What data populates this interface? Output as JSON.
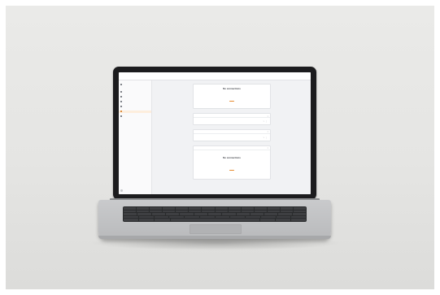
{
  "app": {
    "logo": "",
    "breadcrumb": "",
    "top_right": [
      "",
      "",
      ""
    ]
  },
  "sidebar": {
    "items": [
      {
        "label": "",
        "icon": "home-icon",
        "active": false
      },
      {
        "label": "",
        "icon": "folder-icon",
        "active": false
      },
      {
        "label": "",
        "icon": "chart-icon",
        "active": false
      },
      {
        "label": "",
        "icon": "layers-icon",
        "active": false
      },
      {
        "label": "",
        "icon": "users-icon",
        "active": false
      },
      {
        "label": "",
        "icon": "link-icon",
        "active": true
      },
      {
        "label": "",
        "icon": "gear-icon",
        "active": false
      }
    ],
    "footer": ""
  },
  "cards": {
    "empty_top": {
      "title": "No connections",
      "text": "",
      "button": ""
    },
    "connection_1": {
      "name": "",
      "tag": "",
      "field_a": "",
      "field_b": "",
      "value_a": "",
      "value_b": ""
    },
    "connection_2": {
      "name": "",
      "tag": "",
      "field_a": "",
      "field_b": "",
      "value_a": "",
      "value_b": ""
    },
    "empty_bottom": {
      "header": "",
      "tag": "",
      "title": "No connections",
      "text": "",
      "button": ""
    }
  },
  "colors": {
    "accent": "#e6892d",
    "status_ok": "#4fae57",
    "bezel": "#1c1c1e",
    "chassis": "#c1c2c4"
  }
}
